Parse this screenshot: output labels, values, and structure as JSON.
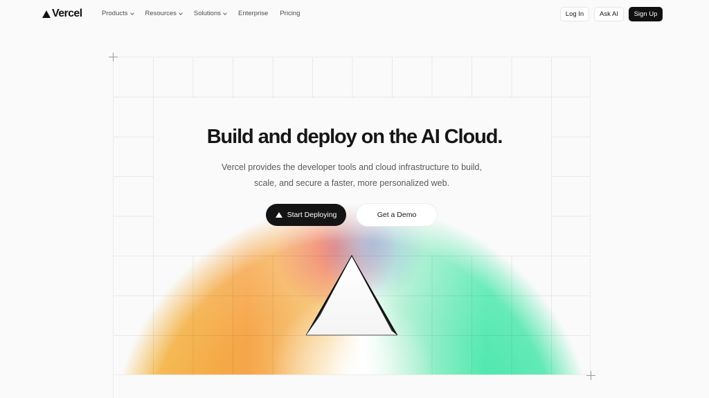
{
  "header": {
    "logo_text": "Vercel",
    "nav": [
      {
        "label": "Products",
        "dropdown": true
      },
      {
        "label": "Resources",
        "dropdown": true
      },
      {
        "label": "Solutions",
        "dropdown": true
      },
      {
        "label": "Enterprise",
        "dropdown": false
      },
      {
        "label": "Pricing",
        "dropdown": false
      }
    ],
    "login_label": "Log In",
    "ask_ai_label": "Ask AI",
    "signup_label": "Sign Up"
  },
  "hero": {
    "title": "Build and deploy on the AI Cloud.",
    "subtitle": "Vercel provides the developer tools and cloud infrastructure to build, scale, and secure a faster, more personalized web.",
    "primary_cta": "Start Deploying",
    "secondary_cta": "Get a Demo"
  },
  "colors": {
    "accent_dark": "#111111",
    "glow_orange": "#f0a030",
    "glow_yellow": "#ecc23a",
    "glow_green": "#3fe3a4",
    "glow_red": "#ee6a6a"
  }
}
